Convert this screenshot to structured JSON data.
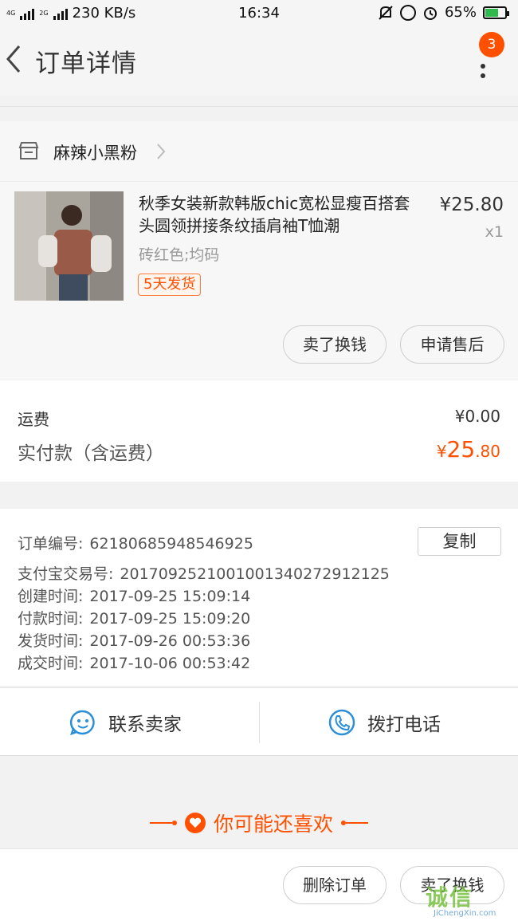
{
  "status_bar": {
    "network_top": "4G",
    "network_bottom": "2G",
    "speed": "230 KB/s",
    "time": "16:34",
    "battery_percent": "65%",
    "battery_level": 0.65,
    "icons": [
      "mute-icon",
      "lock-rotation-icon",
      "alarm-icon",
      "battery-charging-icon"
    ]
  },
  "header": {
    "title": "订单详情",
    "badge_count": "3"
  },
  "shop": {
    "name": "麻辣小黑粉"
  },
  "product": {
    "title": "秋季女装新款韩版chic宽松显瘦百搭套头圆领拼接条纹插肩袖T恤潮",
    "price": "¥25.80",
    "quantity": "x1",
    "sku": "砖红色;均码",
    "shipping_tag": "5天发货"
  },
  "actions": {
    "sell": "卖了换钱",
    "after_sale": "申请售后"
  },
  "totals": {
    "freight_label": "运费",
    "freight_value": "¥0.00",
    "paid_label": "实付款（含运费）",
    "paid_symbol": "¥",
    "paid_int": "25",
    "paid_dec": ".80"
  },
  "order_info": {
    "copy_label": "复制",
    "rows": [
      {
        "label": "订单编号:",
        "value": "62180685948546925"
      },
      {
        "label": "支付宝交易号:",
        "value": "20170925210010013402729121 25"
      },
      {
        "label": "创建时间:",
        "value": "2017-09-25 15:09:14"
      },
      {
        "label": "付款时间:",
        "value": "2017-09-25 15:09:20"
      },
      {
        "label": "发货时间:",
        "value": "2017-09-26 00:53:36"
      },
      {
        "label": "成交时间:",
        "value": "2017-10-06 00:53:42"
      }
    ]
  },
  "contact": {
    "seller": "联系卖家",
    "phone": "拨打电话"
  },
  "recommend": {
    "title": "你可能还喜欢"
  },
  "bottom_bar": {
    "delete": "删除订单",
    "sell": "卖了换钱"
  },
  "watermark": {
    "brand": "诚信",
    "url": "JiChengXin.com"
  },
  "colors": {
    "accent": "#ff5000",
    "contact_icon": "#2a8fd8"
  }
}
